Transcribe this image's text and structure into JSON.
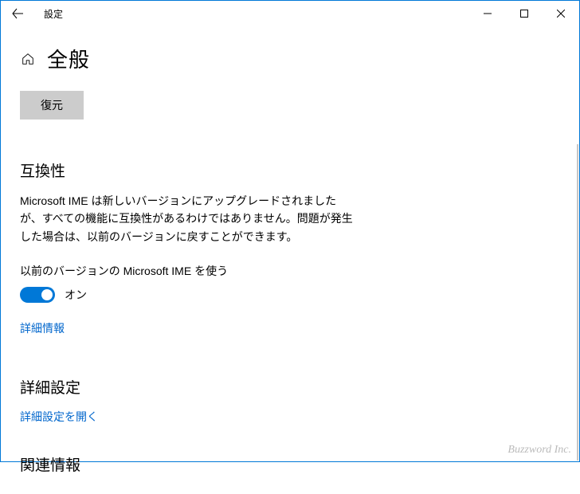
{
  "titlebar": {
    "title": "設定"
  },
  "header": {
    "page_title": "全般",
    "restore_label": "復元"
  },
  "compatibility": {
    "heading": "互換性",
    "description": "Microsoft IME は新しいバージョンにアップグレードされましたが、すべての機能に互換性があるわけではありません。問題が発生した場合は、以前のバージョンに戻すことができます。",
    "toggle_label": "以前のバージョンの Microsoft IME を使う",
    "toggle_state": "オン",
    "info_link": "詳細情報"
  },
  "advanced": {
    "heading": "詳細設定",
    "open_link": "詳細設定を開く"
  },
  "related": {
    "heading": "関連情報"
  },
  "watermark": "Buzzword Inc."
}
